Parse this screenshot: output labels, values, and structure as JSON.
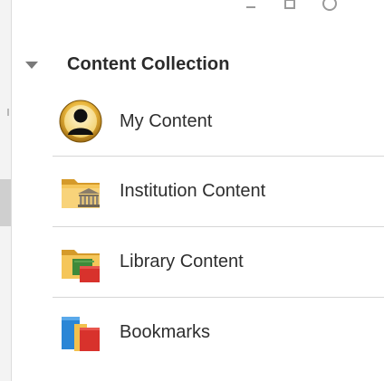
{
  "section": {
    "title": "Content Collection",
    "expanded": true
  },
  "menu": {
    "items": [
      {
        "label": "My Content",
        "icon": "user-avatar-icon"
      },
      {
        "label": "Institution Content",
        "icon": "institution-folder-icon"
      },
      {
        "label": "Library Content",
        "icon": "library-folder-icon"
      },
      {
        "label": "Bookmarks",
        "icon": "bookmarks-icon"
      }
    ]
  },
  "colors": {
    "text": "#2e2e2e",
    "header_text": "#2b2b2b",
    "divider": "#d6d6d6",
    "caret": "#7a7a7a",
    "folder_yellow": "#f2c14e",
    "folder_red": "#d8322c",
    "folder_green": "#3f8a3a",
    "folder_blue": "#2a86d6"
  }
}
